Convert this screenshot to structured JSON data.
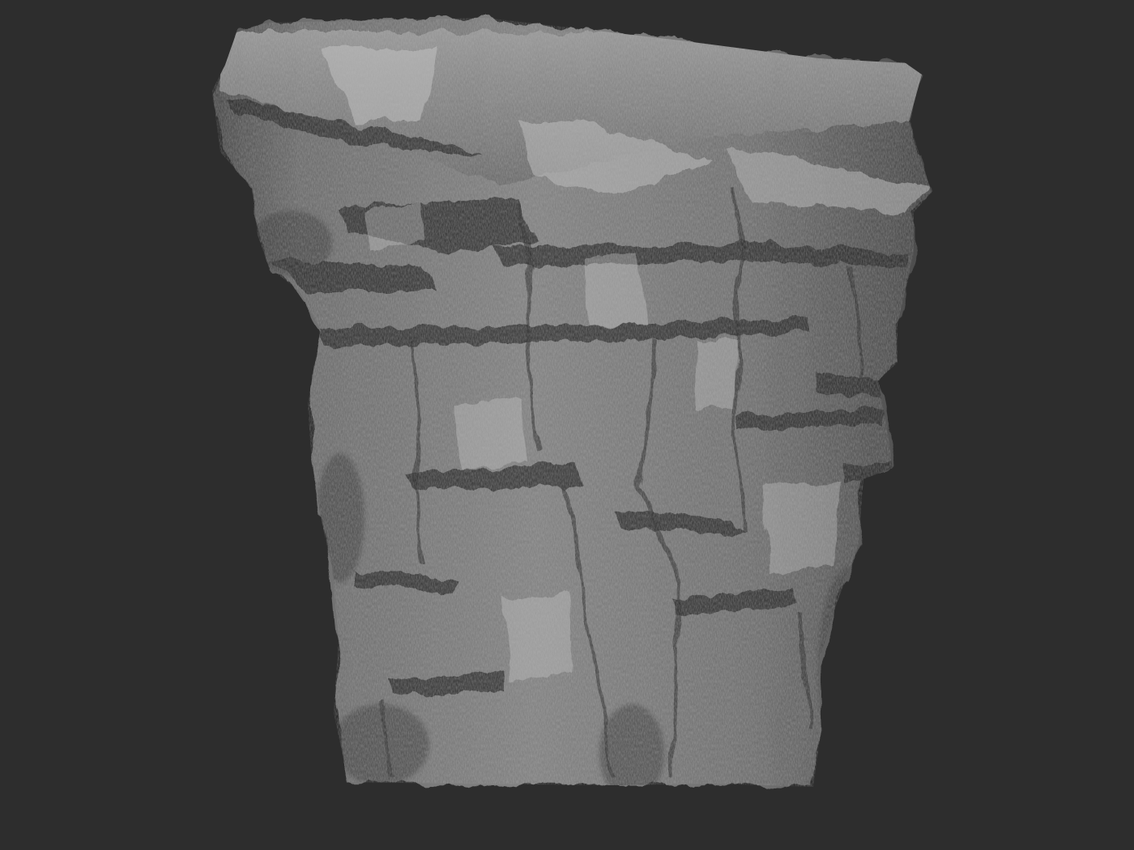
{
  "scene": {
    "subject_icon": "sculpted-rock-cliff-mesh",
    "colors": {
      "background": "#2d2d2d",
      "material_base": "#7c7c7c",
      "material_shadow": "#3a3a3a",
      "material_highlight": "#c9c9c9"
    }
  }
}
